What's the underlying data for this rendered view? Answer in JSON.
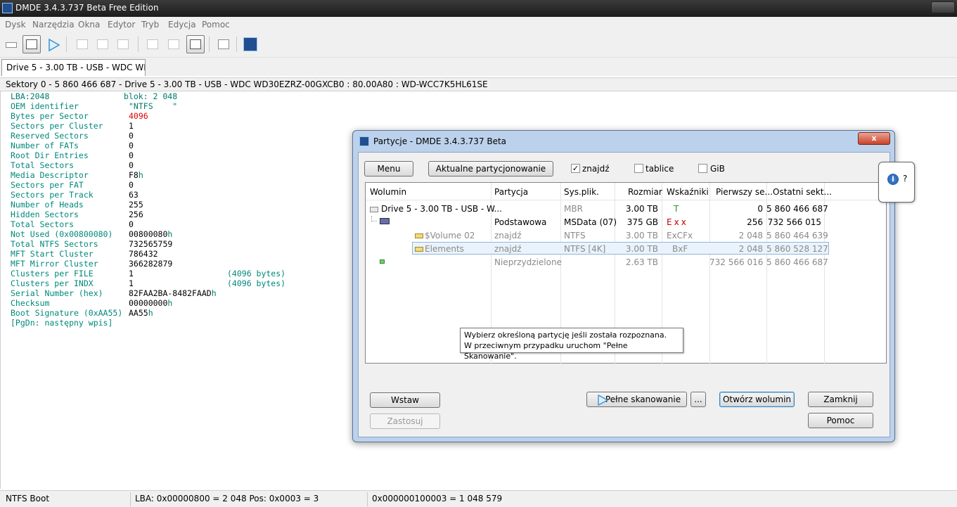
{
  "window": {
    "title": "DMDE 3.4.3.737 Beta Free Edition"
  },
  "menu": [
    "Dysk",
    "Narzędzia",
    "Okna",
    "Edytor",
    "Tryb",
    "Edycja",
    "Pomoc"
  ],
  "tab": {
    "label": "Drive 5 - 3.00 TB - USB - WDC WD3..."
  },
  "sector_bar": "Sektory 0 - 5 860 466 687 - Drive 5 - 3.00 TB - USB - WDC WD30EZRZ-00GXCB0 : 80.00A80 : WD-WCC7K5HL61SE",
  "hex": {
    "lba": "LBA:2048",
    "block": "blok: 2 048",
    "fields": [
      {
        "name": "OEM identifier",
        "value": "\"NTFS    \"",
        "value_color": "teal"
      },
      {
        "name": "Bytes per Sector",
        "value": "4096",
        "value_color": "red"
      },
      {
        "name": "Sectors per Cluster",
        "value": "1"
      },
      {
        "name": "Reserved Sectors",
        "value": "0"
      },
      {
        "name": "Number of FATs",
        "value": "0"
      },
      {
        "name": "Root Dir Entries",
        "value": "0"
      },
      {
        "name": "Total Sectors",
        "value": "0"
      },
      {
        "name": "Media Descriptor",
        "value": "F8",
        "suffix": "h"
      },
      {
        "name": "Sectors per FAT",
        "value": "0"
      },
      {
        "name": "Sectors per Track",
        "value": "63"
      },
      {
        "name": "Number of Heads",
        "value": "255"
      },
      {
        "name": "Hidden Sectors",
        "value": "256"
      },
      {
        "name": "Total Sectors",
        "value": "0"
      },
      {
        "name": "Not Used (0x00800080)",
        "value": "00800080",
        "suffix": "h"
      },
      {
        "name": "Total NTFS Sectors",
        "value": "732565759"
      },
      {
        "name": "MFT Start Cluster",
        "value": "786432"
      },
      {
        "name": "MFT Mirror Cluster",
        "value": "366282879"
      },
      {
        "name": "Clusters per FILE",
        "value": "1",
        "extra": "(4096 bytes)"
      },
      {
        "name": "Clusters per INDX",
        "value": "1",
        "extra": "(4096 bytes)"
      },
      {
        "name": "Serial Number (hex)",
        "value": "82FAA2BA-8482FAAD",
        "suffix": "h"
      },
      {
        "name": "Checksum",
        "value": "00000000",
        "suffix": "h"
      },
      {
        "name": "Boot Signature (0xAA55)",
        "value": "AA55",
        "suffix": "h"
      }
    ],
    "next": "[PgDn: następny wpis]"
  },
  "status": {
    "left": "NTFS Boot",
    "middle": "LBA: 0x00000800 = 2 048  Pos: 0x0003 = 3",
    "right": "0x000000100003 = 1 048 579"
  },
  "dialog": {
    "title": "Partycje - DMDE 3.4.3.737 Beta",
    "close": "x",
    "btn_menu": "Menu",
    "btn_current": "Aktualne partycjonowanie",
    "chk_find": {
      "label": "znajdź",
      "checked": true
    },
    "chk_tables": {
      "label": "tablice",
      "checked": false
    },
    "chk_gib": {
      "label": "GiB",
      "checked": false
    },
    "columns": [
      "Wolumin",
      "Partycja",
      "Sys.plik.",
      "Rozmiar",
      "Wskaźniki",
      "Pierwszy se...",
      "Ostatni sekt..."
    ],
    "rows": [
      {
        "volume": "Drive 5 - 3.00 TB - USB - W...",
        "partition": "",
        "fs": "MBR",
        "size": "3.00 TB",
        "flags": "T",
        "first": "0",
        "last": "5 860 466 687"
      },
      {
        "volume": "",
        "partition": "Podstawowa",
        "fs": "MSData (07)",
        "size": "375 GB",
        "flags_parts": [
          "E",
          "x",
          "x"
        ],
        "first": "256",
        "last": "732 566 015"
      },
      {
        "volume": "$Volume 02",
        "partition": "znajdź",
        "fs": "NTFS",
        "size": "3.00 TB",
        "flags": "ExCFx",
        "first": "2 048",
        "last": "5 860 464 639"
      },
      {
        "volume": "Elements",
        "partition": "znajdź",
        "fs": "NTFS [4K]",
        "size": "3.00 TB",
        "flags": "BxF",
        "first": "2 048",
        "last": "5 860 528 127"
      },
      {
        "volume": "",
        "partition": "Nieprzydzielone",
        "fs": "",
        "size": "2.63 TB",
        "flags": "",
        "first": "732 566 016",
        "last": "5 860 466 687"
      }
    ],
    "tooltip_line1": "Wybierz określoną partycję jeśli została rozpoznana.",
    "tooltip_line2": "W przeciwnym przypadku uruchom \"Pełne Skanowanie\".",
    "btn_insert": "Wstaw",
    "btn_apply": "Zastosuj",
    "btn_fullscan": "Pełne skanowanie",
    "btn_more": "...",
    "btn_open": "Otwórz wolumin",
    "btn_close": "Zamknij",
    "btn_help": "Pomoc",
    "help_q": "?"
  },
  "colors": {
    "accent": "#3c7fb1",
    "teal_text": "#00897b",
    "red_text": "#e00000",
    "dialog_frame": "#bcd2ec"
  }
}
